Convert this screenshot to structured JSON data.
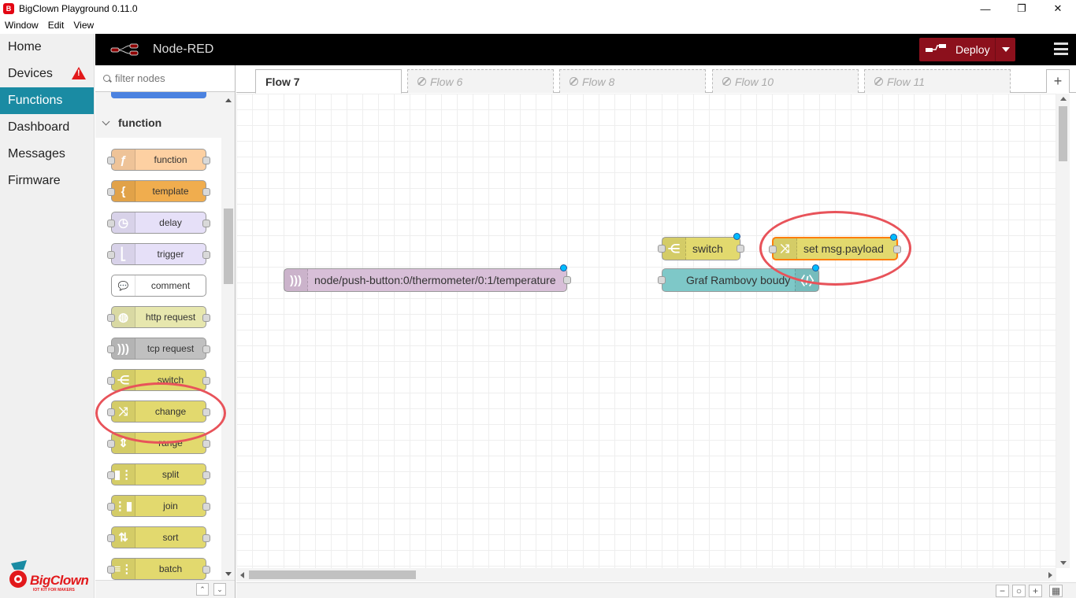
{
  "window": {
    "title": "BigClown Playground 0.11.0",
    "app_icon_glyph": "B",
    "minimize_glyph": "—",
    "restore_glyph": "❐",
    "close_glyph": "✕",
    "menu": [
      "Window",
      "Edit",
      "View"
    ]
  },
  "sidebar": {
    "items": [
      {
        "label": "Home"
      },
      {
        "label": "Devices",
        "warning": true
      },
      {
        "label": "Functions",
        "active": true
      },
      {
        "label": "Dashboard"
      },
      {
        "label": "Messages"
      },
      {
        "label": "Firmware"
      }
    ],
    "logo_text": "BigClown",
    "logo_tagline": "IOT KIT FOR MAKERS",
    "accent": "#1a8ba3"
  },
  "header": {
    "title": "Node-RED",
    "deploy_label": "Deploy",
    "deploy_color": "#8c101c"
  },
  "palette": {
    "filter_placeholder": "filter nodes",
    "category": "function",
    "nodes": [
      {
        "label": "function",
        "color": "#fdd0a2",
        "icon": "ƒ",
        "in": true,
        "out": true
      },
      {
        "label": "template",
        "color": "#f0ad4e",
        "icon": "{",
        "in": true,
        "out": true
      },
      {
        "label": "delay",
        "color": "#e6e0f8",
        "icon": "◷",
        "in": true,
        "out": true
      },
      {
        "label": "trigger",
        "color": "#e6e0f8",
        "icon": "⎣",
        "in": true,
        "out": true
      },
      {
        "label": "comment",
        "color": "#ffffff",
        "icon": "💬",
        "in": false,
        "out": false
      },
      {
        "label": "http request",
        "color": "#e7e7ae",
        "icon": "◍",
        "in": true,
        "out": true
      },
      {
        "label": "tcp request",
        "color": "#c0c0c0",
        "icon": ")))",
        "in": true,
        "out": true
      },
      {
        "label": "switch",
        "color": "#e2d96e",
        "icon": "⋲",
        "in": true,
        "out": true
      },
      {
        "label": "change",
        "color": "#e2d96e",
        "icon": "⤨",
        "in": true,
        "out": true
      },
      {
        "label": "range",
        "color": "#e2d96e",
        "icon": "⇕",
        "in": true,
        "out": true
      },
      {
        "label": "split",
        "color": "#e2d96e",
        "icon": "▮⋮",
        "in": true,
        "out": true
      },
      {
        "label": "join",
        "color": "#e2d96e",
        "icon": "⋮▮",
        "in": true,
        "out": true
      },
      {
        "label": "sort",
        "color": "#e2d96e",
        "icon": "⇅",
        "in": true,
        "out": true
      },
      {
        "label": "batch",
        "color": "#e2d96e",
        "icon": "≡⋮",
        "in": true,
        "out": true
      }
    ],
    "footer_up": "⌃",
    "footer_down": "⌄"
  },
  "tabs": [
    {
      "label": "Flow 7",
      "active": true
    },
    {
      "label": "Flow 6",
      "disabled": true
    },
    {
      "label": "Flow 8",
      "disabled": true
    },
    {
      "label": "Flow 10",
      "disabled": true
    },
    {
      "label": "Flow 11",
      "disabled": true
    }
  ],
  "add_tab_label": "+",
  "flow_nodes": {
    "mqtt_in": {
      "label": "node/push-button:0/thermometer/0:1/temperature",
      "color": "#d8bfd8",
      "icon": ")))"
    },
    "switch": {
      "label": "switch",
      "color": "#e2d96e",
      "icon": "⋲"
    },
    "change": {
      "label": "set msg.payload",
      "color": "#e2d96e",
      "icon": "⤨"
    },
    "chart": {
      "label": "Graf Rambovy boudy",
      "color": "#7ec8c8",
      "icon": "〈/〉"
    }
  },
  "zoom_controls": {
    "zoom_out": "−",
    "reset": "○",
    "zoom_in": "+",
    "navigator": "▦"
  },
  "highlight_color": "#e8535a"
}
